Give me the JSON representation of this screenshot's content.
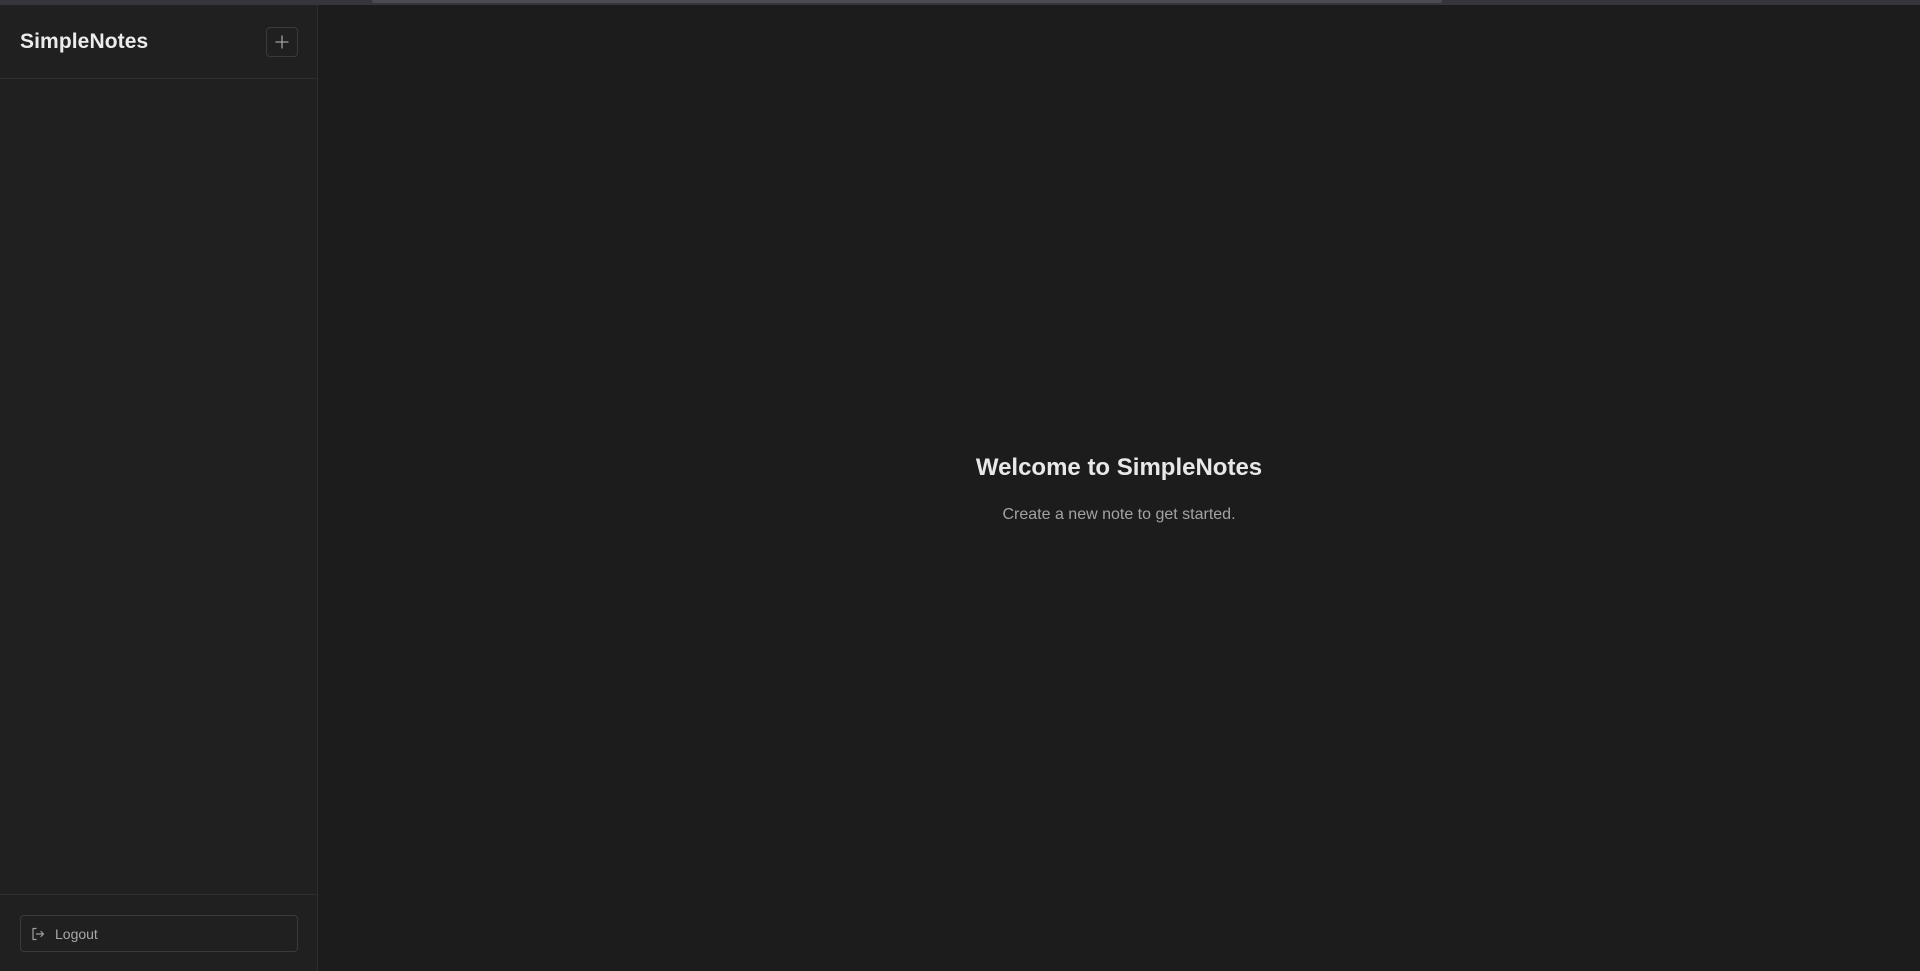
{
  "sidebar": {
    "app_title": "SimpleNotes",
    "new_note_icon": "plus-icon",
    "logout_label": "Logout",
    "logout_icon": "logout-icon"
  },
  "main": {
    "welcome_title": "Welcome to SimpleNotes",
    "welcome_subtitle": "Create a new note to get started."
  },
  "colors": {
    "background": "#1c1c1c",
    "sidebar_background": "#202020",
    "border": "#2e2e2e",
    "text_primary": "#e8e8e8",
    "text_secondary": "#a3a3a3"
  }
}
